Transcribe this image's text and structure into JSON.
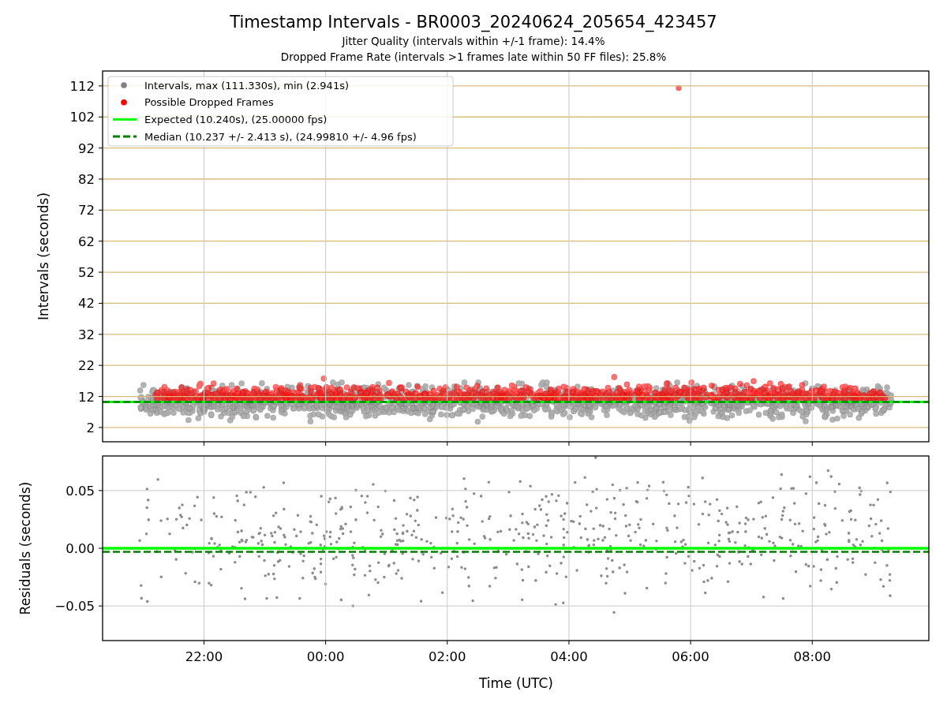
{
  "figure": {
    "title": "Timestamp Intervals - BR0003_20240624_205654_423457",
    "subtitles": [
      "Jitter Quality (intervals within +/-1 frame): 14.4%",
      "Dropped Frame Rate (intervals >1 frames late within 50 FF files): 25.8%"
    ]
  },
  "intervals_plot": {
    "legend": [
      {
        "label": "Intervals, max (111.330s), min (2.941s)",
        "kind": "dot",
        "color": "#808080"
      },
      {
        "label": "Possible Dropped Frames",
        "kind": "dot",
        "color": "#ff0000"
      },
      {
        "label": "Expected (10.240s), (25.00000 fps)",
        "kind": "line",
        "color": "#00ff00"
      },
      {
        "label": "Median (10.237 +/- 2.413 s), (24.99810 +/- 4.96 fps)",
        "kind": "dashed",
        "color": "#008000"
      }
    ],
    "chart_data": {
      "type": "scatter",
      "ylabel": "Intervals (seconds)",
      "grid": true,
      "ylim": [
        -2.6,
        116.8
      ],
      "yticks": [
        {
          "value": 2,
          "label": "2"
        },
        {
          "value": 12,
          "label": "12"
        },
        {
          "value": 22,
          "label": "22"
        },
        {
          "value": 32,
          "label": "32"
        },
        {
          "value": 42,
          "label": "42"
        },
        {
          "value": 52,
          "label": "52"
        },
        {
          "value": 62,
          "label": "62"
        },
        {
          "value": 72,
          "label": "72"
        },
        {
          "value": 82,
          "label": "82"
        },
        {
          "value": 92,
          "label": "92"
        },
        {
          "value": 102,
          "label": "102"
        },
        {
          "value": 112,
          "label": "112"
        }
      ],
      "categories": [
        null,
        null,
        null,
        null,
        null,
        null
      ],
      "ref_lines": [
        {
          "axis": "y",
          "value": 10.2,
          "color": "#00ff00"
        },
        {
          "axis": "y",
          "value": 10.2,
          "color": "#008000"
        }
      ]
    }
  },
  "residuals_plot": {
    "chart_data": {
      "type": "scatter",
      "ylabel": "Residuals (seconds)",
      "xlabel": "Time (UTC)",
      "grid": true,
      "xlim": [
        "2024-06-24T20:20:00",
        "2024-06-25T09:55:00"
      ],
      "ylim": [
        -0.08,
        0.08
      ],
      "xticks": [
        {
          "value": "2024-06-24T22:00:00",
          "label": "22:00"
        },
        {
          "value": "2024-06-25T00:00:00",
          "label": "00:00"
        },
        {
          "value": "2024-06-25T02:00:00",
          "label": "02:00"
        },
        {
          "value": "2024-06-25T04:00:00",
          "label": "04:00"
        },
        {
          "value": "2024-06-25T06:00:00",
          "label": "06:00"
        },
        {
          "value": "2024-06-25T08:00:00",
          "label": "08:00"
        }
      ],
      "yticks": [
        {
          "value": 0.05,
          "label": "0.05"
        },
        {
          "value": 0,
          "label": "0.00"
        },
        {
          "value": -0.05,
          "label": "−0.05"
        }
      ],
      "ref_lines": [
        {
          "axis": "y",
          "value": 0,
          "color": "#00ff00"
        },
        {
          "axis": "y",
          "value": -0.003,
          "color": "#008000"
        }
      ]
    }
  }
}
